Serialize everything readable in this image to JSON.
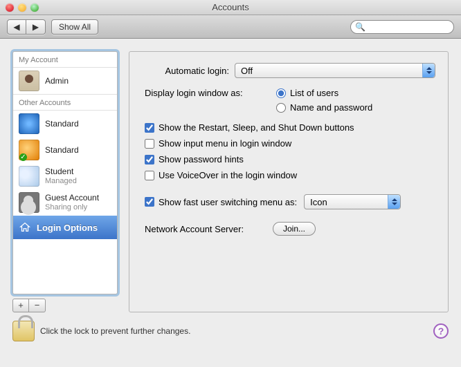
{
  "window": {
    "title": "Accounts"
  },
  "toolbar": {
    "show_all": "Show All",
    "search_placeholder": ""
  },
  "sidebar": {
    "my_account_header": "My Account",
    "other_accounts_header": "Other Accounts",
    "accounts": [
      {
        "name": "Admin",
        "sub": ""
      },
      {
        "name": "Standard",
        "sub": ""
      },
      {
        "name": "Standard",
        "sub": ""
      },
      {
        "name": "Student",
        "sub": "Managed"
      },
      {
        "name": "Guest Account",
        "sub": "Sharing only"
      }
    ],
    "login_options": "Login Options"
  },
  "panel": {
    "auto_login_label": "Automatic login:",
    "auto_login_value": "Off",
    "display_label": "Display login window as:",
    "radio_list": "List of users",
    "radio_namepass": "Name and password",
    "cb_restart": "Show the Restart, Sleep, and Shut Down buttons",
    "cb_input_menu": "Show input menu in login window",
    "cb_pwd_hints": "Show password hints",
    "cb_voiceover": "Use VoiceOver in the login window",
    "cb_fast_user": "Show fast user switching menu as:",
    "fast_user_value": "Icon",
    "network_label": "Network Account Server:",
    "join_btn": "Join..."
  },
  "footer": {
    "lock_text": "Click the lock to prevent further changes."
  }
}
